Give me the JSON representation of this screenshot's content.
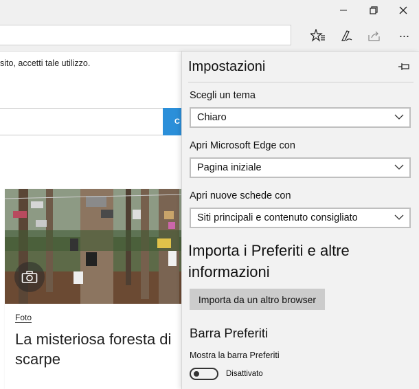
{
  "titlebar": {
    "minimize_icon": "minimize-icon",
    "restore_icon": "restore-icon",
    "close_icon": "close-icon"
  },
  "toolbar": {
    "icons": [
      "favorites-star-icon",
      "pen-note-icon",
      "share-icon",
      "more-dots-icon"
    ],
    "more_glyph": "···"
  },
  "page": {
    "notice": "sito, accetti tale utilizzo.",
    "search_button_label": "C",
    "card": {
      "category": "Foto",
      "headline": "La misteriosa foresta di scarpe",
      "camera_icon": "camera-icon"
    }
  },
  "settings": {
    "title": "Impostazioni",
    "pin_icon": "pin-icon",
    "theme_label": "Scegli un tema",
    "theme_value": "Chiaro",
    "open_with_label": "Apri Microsoft Edge con",
    "open_with_value": "Pagina iniziale",
    "new_tabs_label": "Apri nuove schede con",
    "new_tabs_value": "Siti principali e contenuto consigliato",
    "import_title": "Importa i Preferiti e altre informazioni",
    "import_button": "Importa da un altro browser",
    "favorites_bar_title": "Barra Preferiti",
    "show_favorites_label": "Mostra la barra Preferiti",
    "toggle_state": "Disattivato"
  },
  "colors": {
    "accent": "#2b8fd9",
    "panel_bg": "#f2f2f2",
    "chrome_bg": "#f0f0f0"
  }
}
